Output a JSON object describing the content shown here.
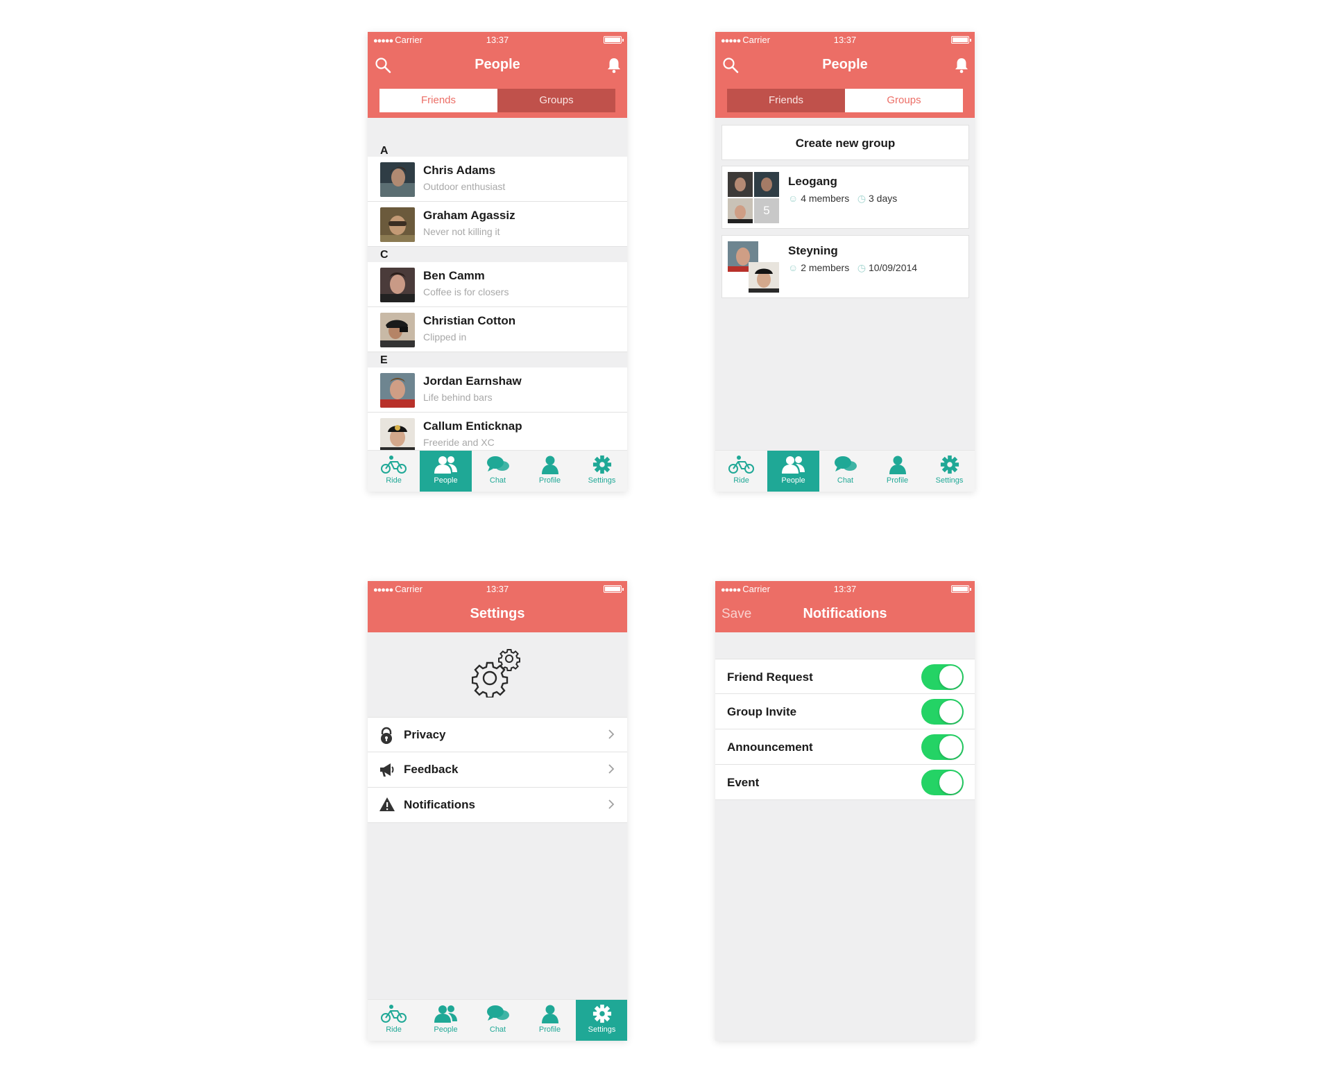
{
  "status": {
    "carrier": "Carrier",
    "time": "13:37"
  },
  "colors": {
    "header": "#ec6e66",
    "accent": "#1fa896",
    "toggle_on": "#24d365"
  },
  "tabs": [
    {
      "label": "Ride",
      "icon": "bicycle-icon"
    },
    {
      "label": "People",
      "icon": "people-icon"
    },
    {
      "label": "Chat",
      "icon": "chat-icon"
    },
    {
      "label": "Profile",
      "icon": "person-icon"
    },
    {
      "label": "Settings",
      "icon": "gear-icon"
    }
  ],
  "screens": {
    "friends": {
      "title": "People",
      "segments": [
        "Friends",
        "Groups"
      ],
      "active_segment": "Friends",
      "active_tab": "People",
      "sections": [
        {
          "letter": "A",
          "people": [
            {
              "name": "Chris Adams",
              "status": "Outdoor enthusiast"
            },
            {
              "name": "Graham Agassiz",
              "status": "Never not killing it"
            }
          ]
        },
        {
          "letter": "C",
          "people": [
            {
              "name": "Ben Camm",
              "status": "Coffee is for closers"
            },
            {
              "name": "Christian Cotton",
              "status": "Clipped in"
            }
          ]
        },
        {
          "letter": "E",
          "people": [
            {
              "name": "Jordan Earnshaw",
              "status": "Life behind bars"
            },
            {
              "name": "Callum Enticknap",
              "status": "Freeride and XC"
            }
          ]
        }
      ]
    },
    "groups": {
      "title": "People",
      "segments": [
        "Friends",
        "Groups"
      ],
      "active_segment": "Groups",
      "active_tab": "People",
      "create_label": "Create new group",
      "groups": [
        {
          "name": "Leogang",
          "members": "4 members",
          "time": "3 days",
          "extra_count": "5"
        },
        {
          "name": "Steyning",
          "members": "2 members",
          "time": "10/09/2014"
        }
      ]
    },
    "settings": {
      "title": "Settings",
      "active_tab": "Settings",
      "items": [
        {
          "label": "Privacy",
          "icon": "lock-icon"
        },
        {
          "label": "Feedback",
          "icon": "megaphone-icon"
        },
        {
          "label": "Notifications",
          "icon": "warning-icon"
        }
      ]
    },
    "notifications": {
      "title": "Notifications",
      "save_label": "Save",
      "items": [
        {
          "label": "Friend Request",
          "on": true
        },
        {
          "label": "Group Invite",
          "on": true
        },
        {
          "label": "Announcement",
          "on": true
        },
        {
          "label": "Event",
          "on": true
        }
      ]
    }
  }
}
